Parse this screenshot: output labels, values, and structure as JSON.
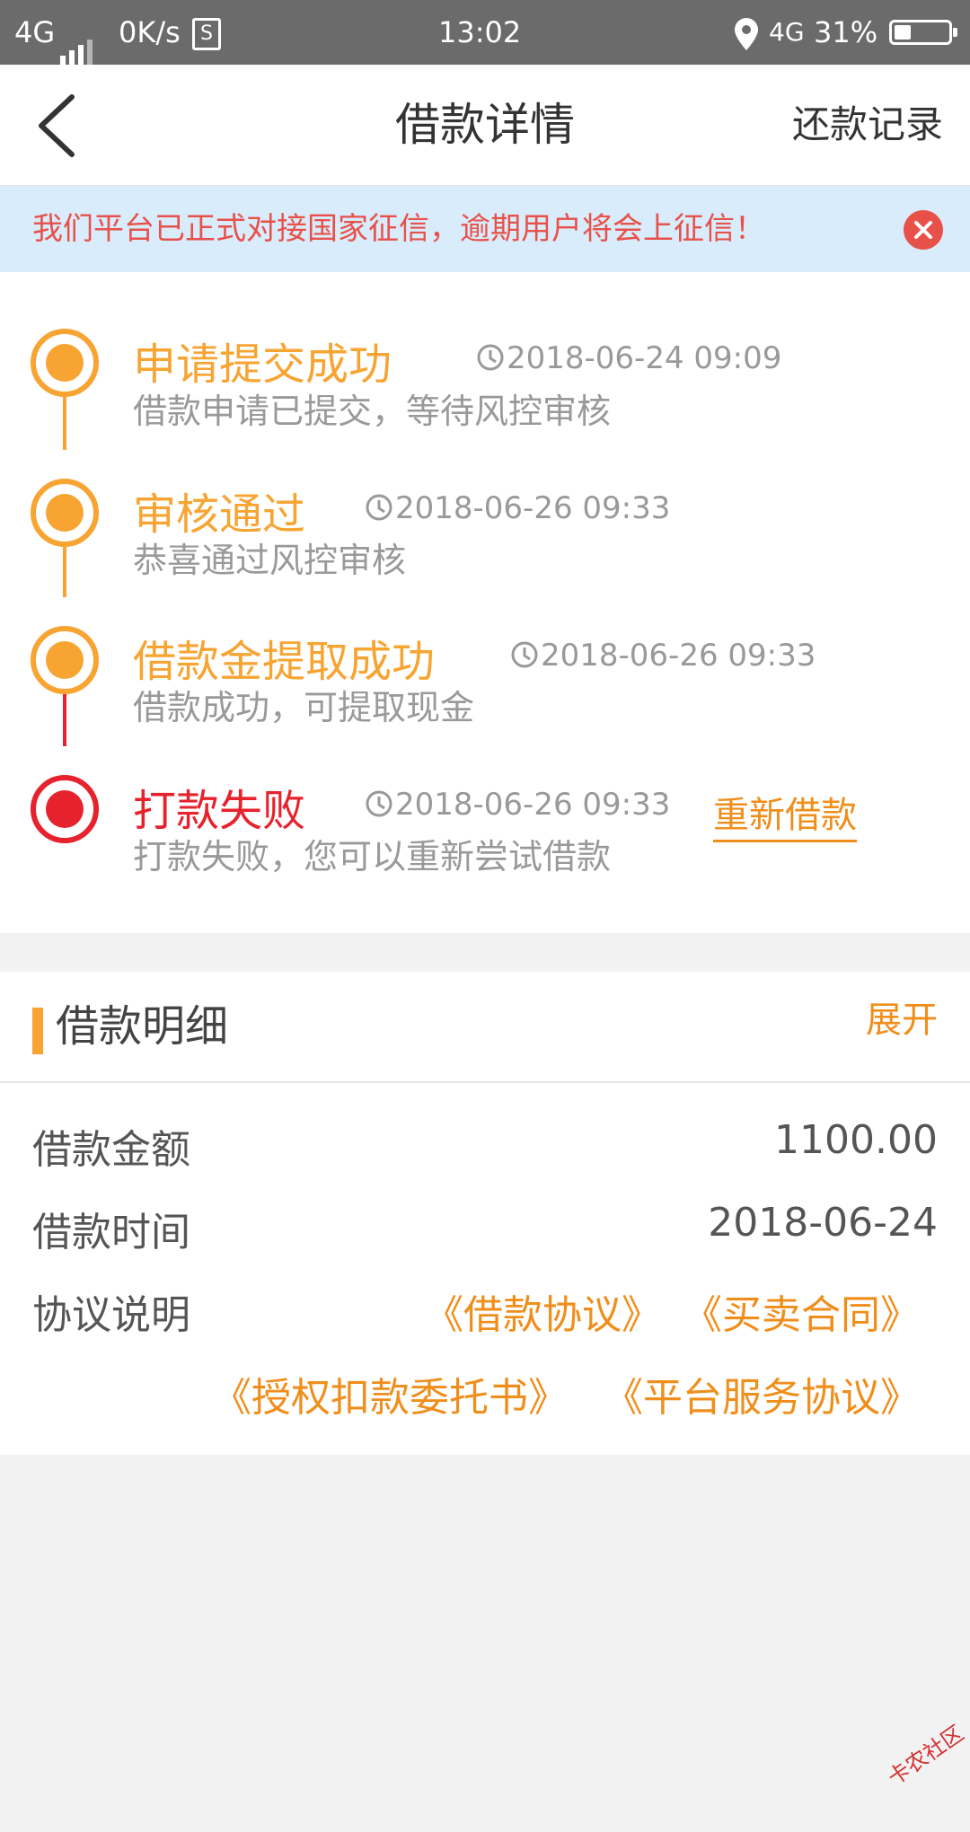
{
  "status_bar": {
    "network": "4G",
    "speed": "0K/s",
    "sim_icon": "S",
    "time": "13:02",
    "network_right": "4G",
    "battery_percent": "31%",
    "battery_level": 0.31
  },
  "nav": {
    "title": "借款详情",
    "right_label": "还款记录"
  },
  "notice": {
    "text": "我们平台已正式对接国家征信，逾期用户将会上征信！"
  },
  "timeline": [
    {
      "title": "申请提交成功",
      "time": "2018-06-24 09:09",
      "desc": "借款申请已提交，等待风控审核",
      "status": "done"
    },
    {
      "title": "审核通过",
      "time": "2018-06-26 09:33",
      "desc": "恭喜通过风控审核",
      "status": "done"
    },
    {
      "title": "借款金提取成功",
      "time": "2018-06-26 09:33",
      "desc": "借款成功，可提取现金",
      "status": "done"
    },
    {
      "title": "打款失败",
      "time": "2018-06-26 09:33",
      "desc": "打款失败，您可以重新尝试借款",
      "status": "failed",
      "action": "重新借款"
    }
  ],
  "detail": {
    "title": "借款明细",
    "expand_label": "展开",
    "rows": [
      {
        "label": "借款金额",
        "value": "1100.00"
      },
      {
        "label": "借款时间",
        "value": "2018-06-24"
      }
    ],
    "agreement_label": "协议说明",
    "agreements": [
      "《借款协议》",
      "《买卖合同》",
      "《授权扣款委托书》",
      "《平台服务协议》"
    ]
  },
  "watermark": "卡农社区",
  "colors": {
    "accent_orange": "#f7a432",
    "link_orange": "#f08e1b",
    "fail_red": "#e6222c",
    "notice_bg": "#d9ecfb",
    "notice_text": "#e8514a"
  }
}
